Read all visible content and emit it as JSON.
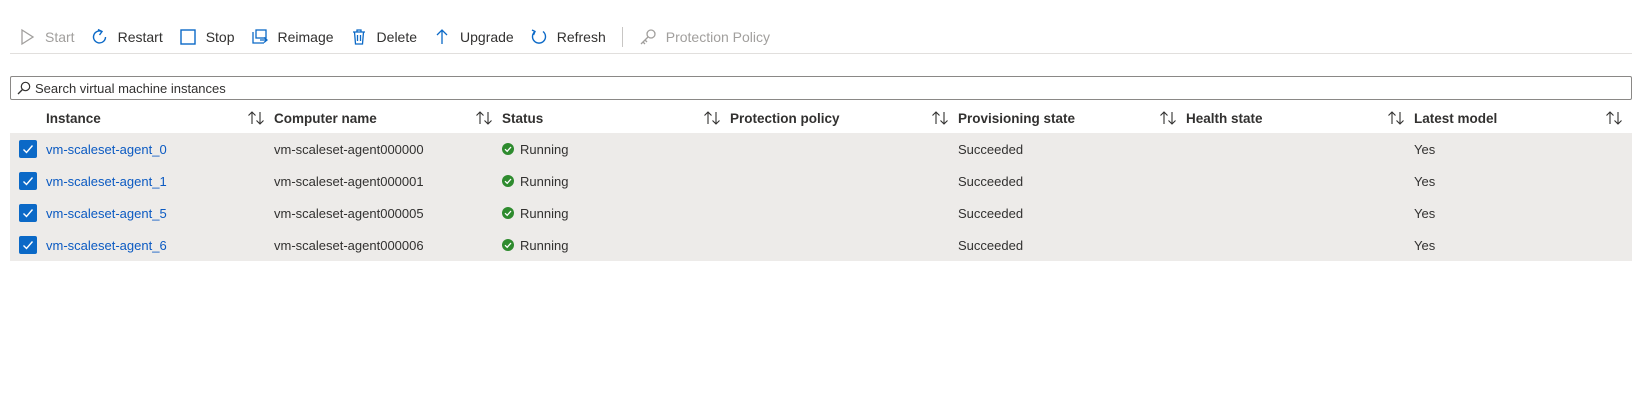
{
  "toolbar": {
    "start": "Start",
    "restart": "Restart",
    "stop": "Stop",
    "reimage": "Reimage",
    "delete": "Delete",
    "upgrade": "Upgrade",
    "refresh": "Refresh",
    "protection_policy": "Protection Policy"
  },
  "search": {
    "placeholder": "Search virtual machine instances",
    "value": ""
  },
  "table": {
    "columns": [
      "Instance",
      "Computer name",
      "Status",
      "Protection policy",
      "Provisioning state",
      "Health state",
      "Latest model"
    ],
    "rows": [
      {
        "instance": "vm-scaleset-agent_0",
        "computer_name": "vm-scaleset-agent000000",
        "status": "Running",
        "protection_policy": "",
        "provisioning_state": "Succeeded",
        "health_state": "",
        "latest_model": "Yes",
        "selected": true
      },
      {
        "instance": "vm-scaleset-agent_1",
        "computer_name": "vm-scaleset-agent000001",
        "status": "Running",
        "protection_policy": "",
        "provisioning_state": "Succeeded",
        "health_state": "",
        "latest_model": "Yes",
        "selected": true
      },
      {
        "instance": "vm-scaleset-agent_5",
        "computer_name": "vm-scaleset-agent000005",
        "status": "Running",
        "protection_policy": "",
        "provisioning_state": "Succeeded",
        "health_state": "",
        "latest_model": "Yes",
        "selected": true
      },
      {
        "instance": "vm-scaleset-agent_6",
        "computer_name": "vm-scaleset-agent000006",
        "status": "Running",
        "protection_policy": "",
        "provisioning_state": "Succeeded",
        "health_state": "",
        "latest_model": "Yes",
        "selected": true
      }
    ]
  },
  "colors": {
    "accent": "#0b69c7",
    "link": "#0b5ac2",
    "status_running": "#2e8b2e",
    "row_selected_bg": "#edebe9",
    "disabled_text": "#a19f9d"
  },
  "icons": {
    "start": "play-icon",
    "restart": "restart-icon",
    "stop": "stop-icon",
    "reimage": "reimage-icon",
    "delete": "trash-icon",
    "upgrade": "arrow-up-icon",
    "refresh": "refresh-icon",
    "protection_policy": "key-icon",
    "search": "search-icon",
    "sort": "sort-icon",
    "status": "check-circle-icon"
  }
}
